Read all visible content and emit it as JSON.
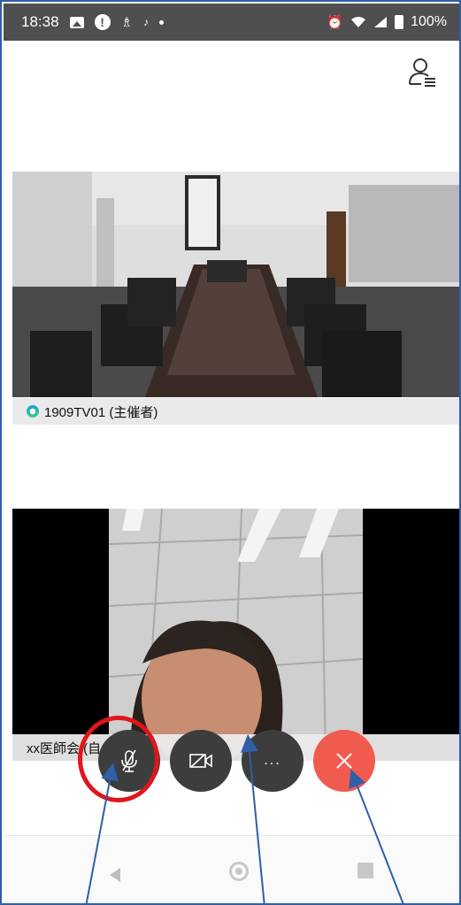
{
  "status_bar": {
    "time": "18:38",
    "battery": "100%"
  },
  "header": {
    "participants_icon": "participants-icon"
  },
  "videos": {
    "host": {
      "label": "1909TV01 (主催者)"
    },
    "self": {
      "label": "xx医師会 (自分)"
    }
  },
  "controls": {
    "mute_icon": "mic-off-icon",
    "video_icon": "video-off-icon",
    "more_label": "...",
    "leave_icon": "close-icon"
  },
  "nav": {
    "back_icon": "back-icon",
    "home_icon": "home-icon",
    "recent_icon": "recent-apps-icon"
  },
  "colors": {
    "leave": "#f15b4f",
    "control_dark": "#3d3d3d",
    "highlight": "#e0161c",
    "annotation": "#2f5fa7"
  }
}
